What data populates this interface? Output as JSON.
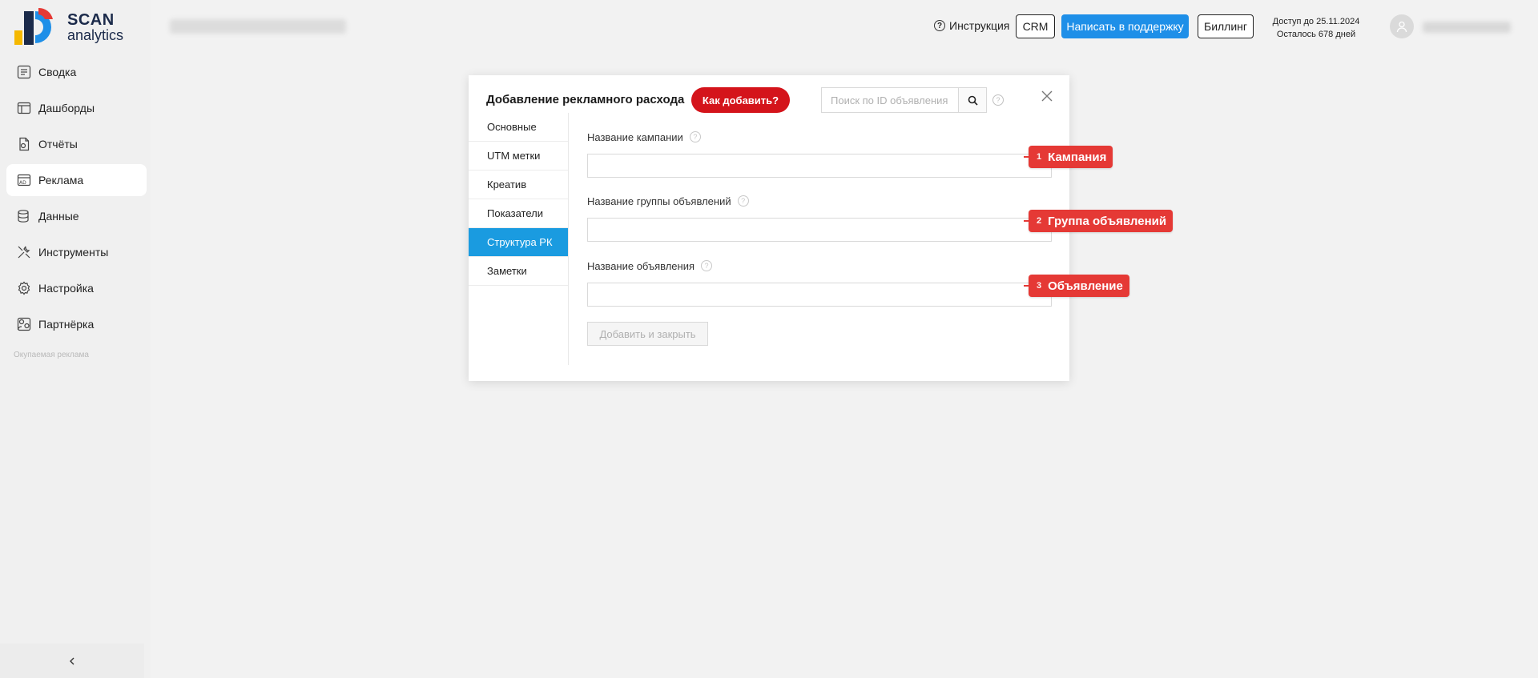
{
  "brand": {
    "line1": "SCAN",
    "line2": "analytics"
  },
  "sidebar": {
    "items": [
      {
        "label": "Сводка",
        "icon": "summary-icon"
      },
      {
        "label": "Дашборды",
        "icon": "dashboard-icon"
      },
      {
        "label": "Отчёты",
        "icon": "reports-icon"
      },
      {
        "label": "Реклама",
        "icon": "ads-icon",
        "active": true
      },
      {
        "label": "Данные",
        "icon": "database-icon"
      },
      {
        "label": "Инструменты",
        "icon": "tools-icon"
      },
      {
        "label": "Настройка",
        "icon": "settings-icon"
      },
      {
        "label": "Партнёрка",
        "icon": "partner-icon"
      }
    ],
    "footer_text": "Окупаемая реклама"
  },
  "header": {
    "instruction_label": "Инструкция",
    "crm_label": "CRM",
    "support_label": "Написать в поддержку",
    "billing_label": "Биллинг",
    "access_line1": "Доступ до 25.11.2024",
    "access_line2": "Осталось 678 дней"
  },
  "modal": {
    "title": "Добавление рекламного расхода",
    "how_add_label": "Как добавить?",
    "search_placeholder": "Поиск по ID объявления",
    "tabs": [
      {
        "label": "Основные"
      },
      {
        "label": "UTM метки"
      },
      {
        "label": "Креатив"
      },
      {
        "label": "Показатели"
      },
      {
        "label": "Структура РК",
        "active": true
      },
      {
        "label": "Заметки"
      }
    ],
    "fields": [
      {
        "label": "Название кампании",
        "value": ""
      },
      {
        "label": "Название группы объявлений",
        "value": ""
      },
      {
        "label": "Название объявления",
        "value": ""
      }
    ],
    "submit_label": "Добавить и закрыть"
  },
  "annotations": [
    {
      "num": "1",
      "text": "Кампания"
    },
    {
      "num": "2",
      "text": "Группа объявлений"
    },
    {
      "num": "3",
      "text": "Объявление"
    }
  ],
  "colors": {
    "accent_blue": "#1e8fe8",
    "active_tab": "#1a9be0",
    "how_add_red": "#d4141b",
    "tag_red": "#e53935"
  }
}
